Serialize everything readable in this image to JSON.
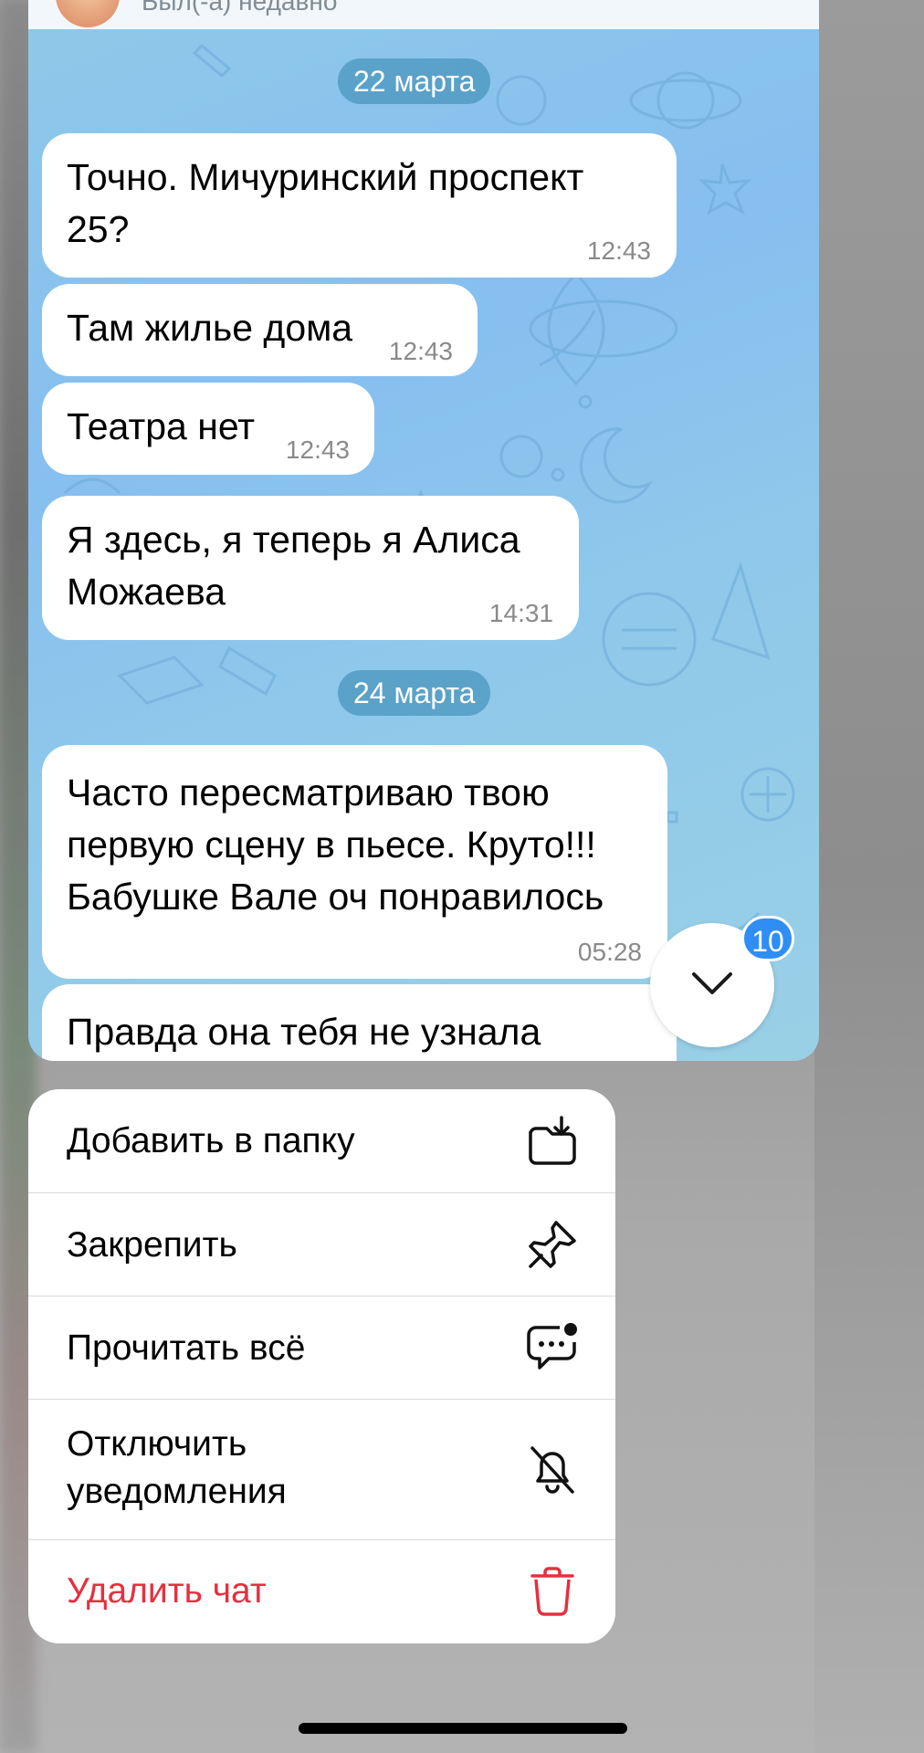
{
  "chat": {
    "header_status": "Был(-а) недавно",
    "dates": {
      "first": "22 марта",
      "second": "24 марта"
    },
    "messages": [
      {
        "lines": [
          "Точно. Мичуринский проспект",
          "25?"
        ],
        "time": "12:43"
      },
      {
        "lines": [
          "Там жилье дома"
        ],
        "time": "12:43"
      },
      {
        "lines": [
          "Театра нет"
        ],
        "time": "12:43"
      },
      {
        "lines": [
          "Я здесь, я теперь я Алиса",
          "Можаева"
        ],
        "time": "14:31"
      },
      {
        "lines": [
          "Часто пересматриваю твою",
          "первую сцену в пьесе. Круто!!!",
          "Бабушке Вале оч понравилось"
        ],
        "time": "05:28"
      },
      {
        "lines": [
          "Правда она тебя не узнала"
        ],
        "time": ""
      }
    ],
    "unread_count": "10"
  },
  "menu": {
    "items": [
      {
        "label": "Добавить в папку",
        "icon": "folder-add-icon"
      },
      {
        "label": "Закрепить",
        "icon": "pin-icon"
      },
      {
        "label": "Прочитать всё",
        "icon": "chat-read-icon"
      },
      {
        "label_lines": [
          "Отключить",
          "уведомления"
        ],
        "icon": "bell-off-icon"
      },
      {
        "label": "Удалить чат",
        "icon": "trash-icon",
        "color": "#e5303f"
      }
    ]
  },
  "colors": {
    "accent": "#2f8ef4",
    "danger": "#e5303f",
    "date_pill": "#4a96be"
  }
}
